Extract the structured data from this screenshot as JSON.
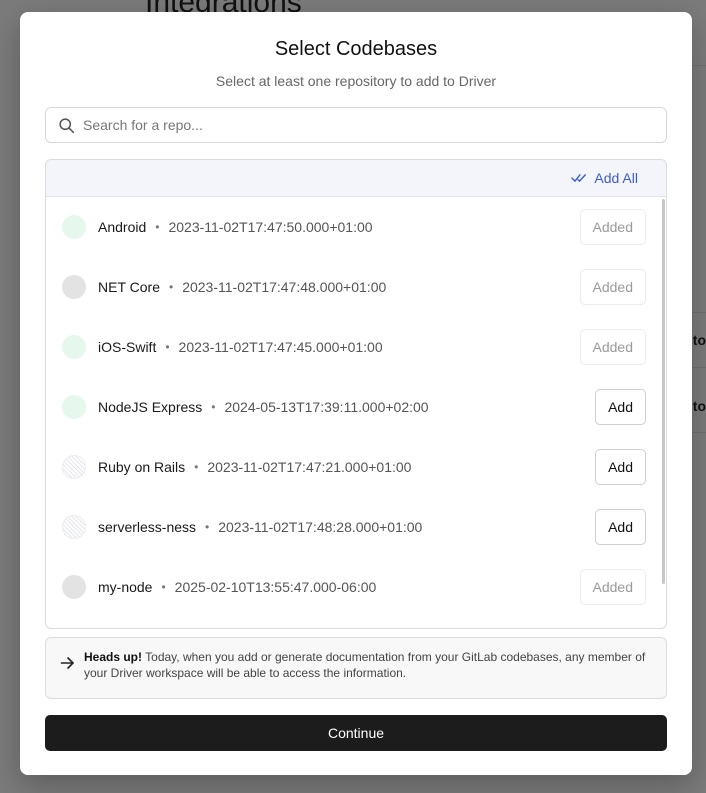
{
  "background": {
    "page_title": "Integrations",
    "side_texts": [
      "to",
      "to"
    ]
  },
  "modal": {
    "title": "Select Codebases",
    "subtitle": "Select at least one repository to add to Driver",
    "search": {
      "placeholder": "Search for a repo..."
    },
    "add_all_label": "Add All",
    "repos": [
      {
        "name": "Android",
        "date": "2023-11-02T17:47:50.000+01:00",
        "status": "Added",
        "avatar": "green"
      },
      {
        "name": "NET Core",
        "date": "2023-11-02T17:47:48.000+01:00",
        "status": "Added",
        "avatar": "gray"
      },
      {
        "name": "iOS-Swift",
        "date": "2023-11-02T17:47:45.000+01:00",
        "status": "Added",
        "avatar": "green"
      },
      {
        "name": "NodeJS Express",
        "date": "2024-05-13T17:39:11.000+02:00",
        "status": "Add",
        "avatar": "green"
      },
      {
        "name": "Ruby on Rails",
        "date": "2023-11-02T17:47:21.000+01:00",
        "status": "Add",
        "avatar": "hatch"
      },
      {
        "name": "serverless-ness",
        "date": "2023-11-02T17:48:28.000+01:00",
        "status": "Add",
        "avatar": "hatch"
      },
      {
        "name": "my-node",
        "date": "2025-02-10T13:55:47.000-06:00",
        "status": "Added",
        "avatar": "gray"
      }
    ],
    "separator": "•",
    "notice": {
      "heading": "Heads up!",
      "text": "Today, when you add or generate documentation from your GitLab codebases, any member of your Driver workspace will be able to access the information."
    },
    "continue_label": "Continue"
  },
  "colors": {
    "accent": "#3f5bd0",
    "primary_button": "#1c1c1c"
  }
}
